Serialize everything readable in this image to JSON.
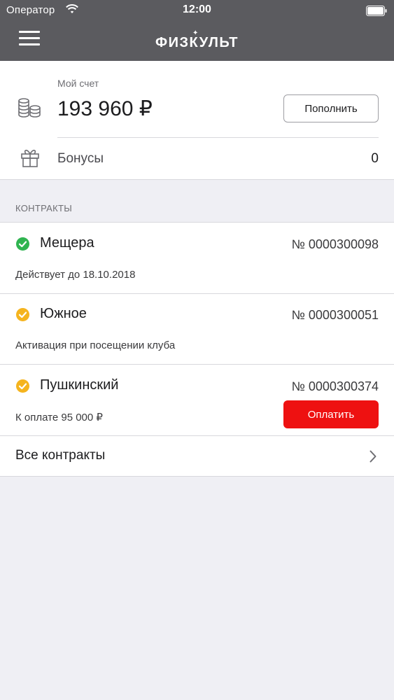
{
  "status_bar": {
    "carrier": "Оператор",
    "time": "12:00"
  },
  "nav": {
    "logo": "ФИЗКУЛЬТ",
    "menu_icon": "hamburger-menu-icon"
  },
  "account": {
    "label": "Мой счет",
    "balance": "193 960 ₽",
    "topup_label": "Пополнить",
    "icon": "coins-icon",
    "bonus_label": "Бонусы",
    "bonus_value": "0",
    "bonus_icon": "gift-icon"
  },
  "contracts": {
    "section_title": "КОНТРАКТЫ",
    "items": [
      {
        "name": "Мещера",
        "number": "№ 0000300098",
        "status_text": "Действует до 18.10.2018",
        "status": "active",
        "status_color": "#2fb450"
      },
      {
        "name": "Южное",
        "number": "№ 0000300051",
        "status_text": "Активация при посещении клуба",
        "status": "pending",
        "status_color": "#f5b41e"
      },
      {
        "name": "Пушкинский",
        "number": "№ 0000300374",
        "status_text": "К оплате 95 000 ₽",
        "status": "pending",
        "status_color": "#f5b41e",
        "pay_label": "Оплатить"
      }
    ],
    "all_label": "Все контракты"
  },
  "colors": {
    "header_bg": "#5b5b5f",
    "accent_red": "#ee1111",
    "page_bg": "#efeff4"
  }
}
